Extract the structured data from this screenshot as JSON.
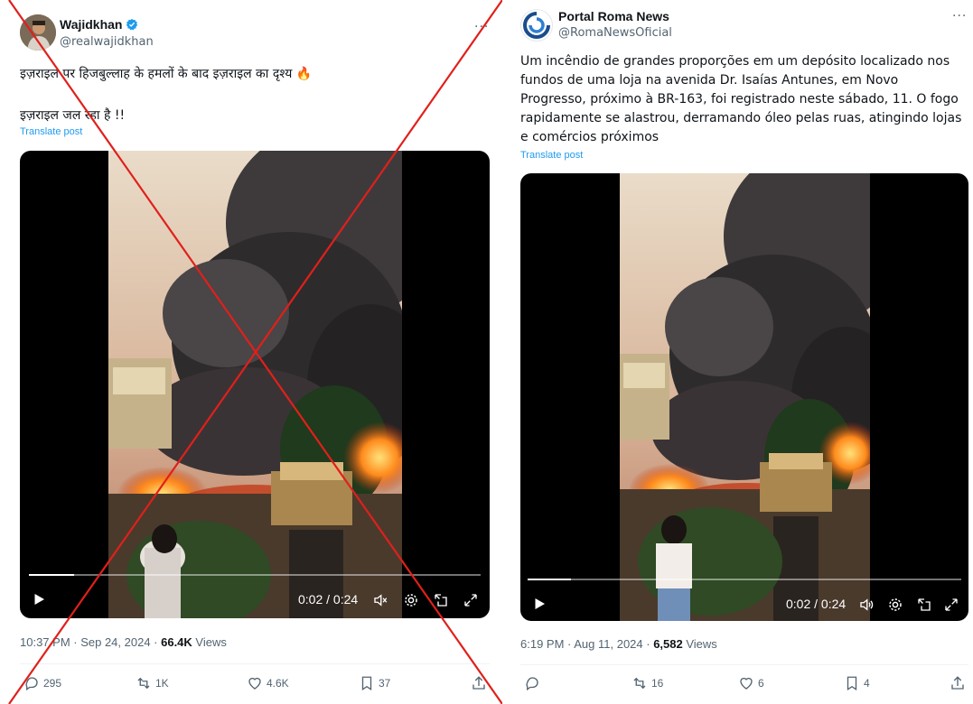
{
  "left_post": {
    "author_name": "Wajidkhan",
    "handle": "@realwajidkhan",
    "more": "···",
    "text_line1": "इज़राइल पर हिजबुल्लाह के हमलों के बाद इज़राइल का दृश्य 🔥",
    "text_line2": "इज़राइल जल रहा है !!",
    "translate": "Translate post",
    "video": {
      "time": "0:02 / 0:24",
      "progress": 0.1
    },
    "timestamp": "10:37 PM · Sep 24, 2024 · ",
    "views_count": "66.4K",
    "views_label": " Views",
    "actions": {
      "replies": "295",
      "reposts": "1K",
      "likes": "4.6K",
      "bookmarks": "37"
    }
  },
  "right_post": {
    "author_name": "Portal Roma News",
    "handle": "@RomaNewsOficial",
    "more": "···",
    "text": "Um incêndio de grandes proporções em um depósito localizado nos fundos de uma loja na avenida Dr. Isaías Antunes, em Novo Progresso, próximo à BR-163, foi registrado neste sábado, 11. O fogo rapidamente se alastrou, derramando óleo pelas ruas, atingindo lojas e comércios próximos",
    "translate": "Translate post",
    "video": {
      "time": "0:02 / 0:24",
      "progress": 0.1
    },
    "timestamp": "6:19 PM · Aug 11, 2024 · ",
    "views_count": "6,582",
    "views_label": " Views",
    "actions": {
      "replies": "",
      "reposts": "16",
      "likes": "6",
      "bookmarks": "4"
    }
  },
  "colors": {
    "link": "#1d9bf0",
    "secondary_text": "#536471",
    "cross": "#e0201b",
    "verified": "#1d9bf0"
  }
}
